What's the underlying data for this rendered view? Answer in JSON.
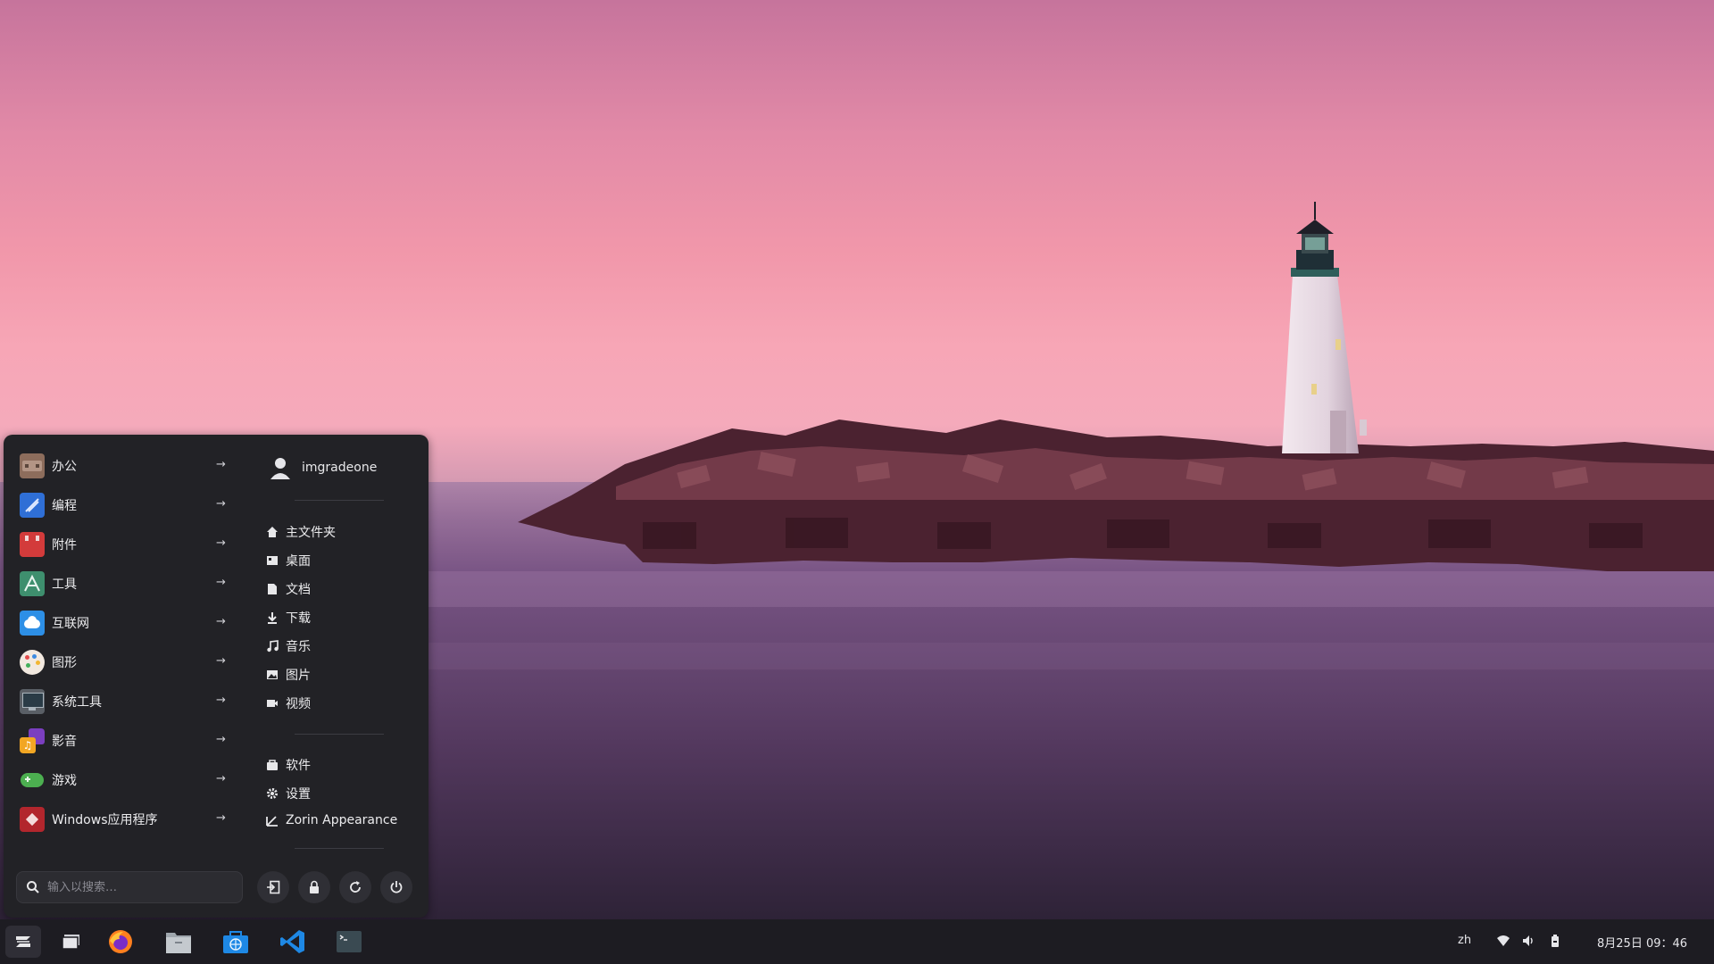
{
  "start_menu": {
    "categories": [
      {
        "label": "办公",
        "icon": "office-icon"
      },
      {
        "label": "编程",
        "icon": "programming-icon"
      },
      {
        "label": "附件",
        "icon": "accessories-icon"
      },
      {
        "label": "工具",
        "icon": "utilities-icon"
      },
      {
        "label": "互联网",
        "icon": "internet-icon"
      },
      {
        "label": "图形",
        "icon": "graphics-icon"
      },
      {
        "label": "系统工具",
        "icon": "system-tools-icon"
      },
      {
        "label": "影音",
        "icon": "multimedia-icon"
      },
      {
        "label": "游戏",
        "icon": "games-icon"
      },
      {
        "label": "Windows应用程序",
        "icon": "windows-apps-icon"
      }
    ],
    "user": {
      "name": "imgradeone"
    },
    "places": [
      {
        "label": "主文件夹",
        "icon": "home-icon"
      },
      {
        "label": "桌面",
        "icon": "desktop-icon"
      },
      {
        "label": "文档",
        "icon": "document-icon"
      },
      {
        "label": "下载",
        "icon": "download-icon"
      },
      {
        "label": "音乐",
        "icon": "music-icon"
      },
      {
        "label": "图片",
        "icon": "picture-icon"
      },
      {
        "label": "视频",
        "icon": "video-icon"
      }
    ],
    "system_items": [
      {
        "label": "软件",
        "icon": "software-icon"
      },
      {
        "label": "设置",
        "icon": "settings-icon"
      },
      {
        "label": "Zorin Appearance",
        "icon": "appearance-icon"
      }
    ],
    "search": {
      "placeholder": "输入以搜索…",
      "value": ""
    },
    "session_buttons": [
      "logout-icon",
      "lock-icon",
      "restart-icon",
      "power-icon"
    ]
  },
  "taskbar": {
    "apps": [
      "zorin-menu-icon",
      "show-desktop-icon",
      "firefox-icon",
      "files-icon",
      "software-store-icon",
      "vscode-icon",
      "terminal-icon"
    ],
    "tray": {
      "language": "zh",
      "clock": "8月25日 09：46"
    }
  },
  "colors": {
    "menu_bg": "#222226",
    "taskbar_bg": "#1d1c22",
    "sky_top": "#c6749c",
    "sky_horizon": "#f5aabb",
    "water": "#573e66"
  }
}
